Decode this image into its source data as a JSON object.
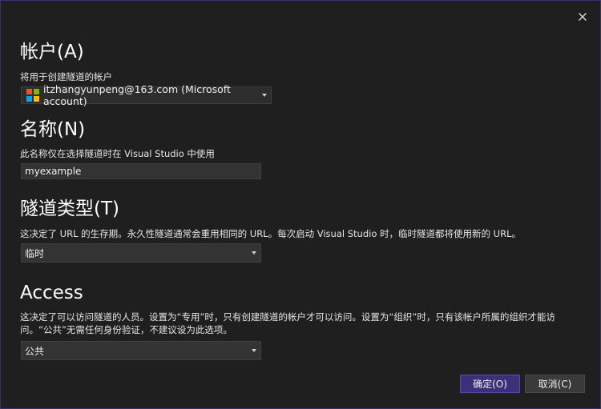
{
  "dialog": {
    "close_label": "✕"
  },
  "account": {
    "heading": "帐户(A)",
    "description": "将用于创建隧道的帐户",
    "selected": "itzhangyunpeng@163.com (Microsoft account)",
    "logo_colors": [
      "#f25022",
      "#7fba00",
      "#00a4ef",
      "#ffb900"
    ]
  },
  "name": {
    "heading": "名称(N)",
    "description": "此名称仅在选择隧道时在 Visual Studio 中使用",
    "value": "myexample"
  },
  "tunnel_type": {
    "heading": "隧道类型(T)",
    "description": "这决定了 URL 的生存期。永久性隧道通常会重用相同的 URL。每次启动 Visual Studio 时，临时隧道都将使用新的 URL。",
    "selected": "临时"
  },
  "access": {
    "heading": "Access",
    "description_line1": "这决定了可以访问隧道的人员。设置为“专用”时，只有创建隧道的帐户才可以访问。设置为“组织”时，只有该帐户所属的组织才能访",
    "description_line2": "问。“公共”无需任何身份验证，不建议设为此选项。",
    "selected": "公共"
  },
  "buttons": {
    "ok": "确定(O)",
    "cancel": "取消(C)"
  },
  "colors": {
    "background": "#1f1f1f",
    "accent": "#3e2f7a"
  }
}
